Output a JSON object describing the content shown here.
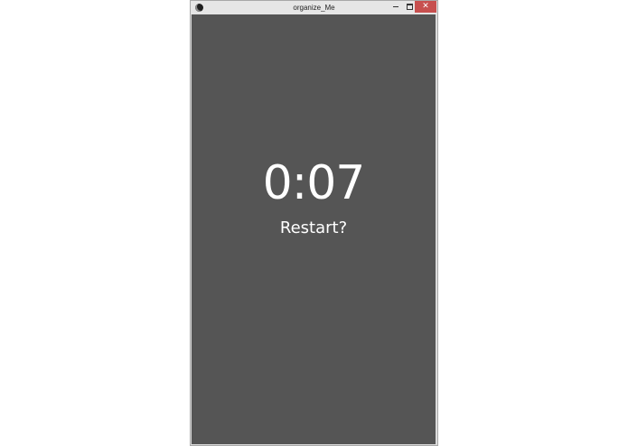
{
  "window": {
    "title": "organize_Me",
    "controls": {
      "minimize_icon": "minimize-icon",
      "maximize_icon": "maximize-icon",
      "close_icon": "close-icon",
      "close_glyph": "✕"
    }
  },
  "app": {
    "timer_value": "0:07",
    "restart_label": "Restart?"
  },
  "colors": {
    "background": "#555555",
    "text": "#ffffff",
    "close_button": "#c7504f"
  }
}
